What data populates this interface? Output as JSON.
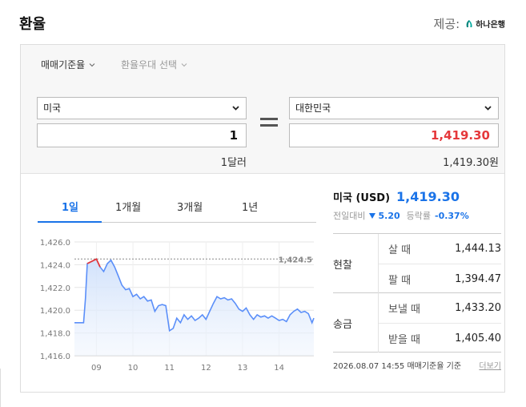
{
  "header": {
    "title": "환율",
    "provider_label": "제공:",
    "provider_name": "하나은행"
  },
  "selectors": {
    "basis_label": "매매기준율",
    "preference_label": "환율우대 선택"
  },
  "converter": {
    "from_country": "미국",
    "from_amount": "1",
    "from_unit_note": "1달러",
    "to_country": "대한민국",
    "to_amount": "1,419.30",
    "to_unit_note": "1,419.30원"
  },
  "tabs": [
    "1일",
    "1개월",
    "3개월",
    "1년"
  ],
  "info": {
    "currency_name": "미국 (USD)",
    "rate": "1,419.30",
    "prev_label": "전일대비",
    "change": "5.20",
    "pct_label": "등락률",
    "pct": "-0.37%"
  },
  "rates": [
    {
      "group": "현찰",
      "rows": [
        {
          "label": "살 때",
          "value": "1,444.13"
        },
        {
          "label": "팔 때",
          "value": "1,394.47"
        }
      ]
    },
    {
      "group": "송금",
      "rows": [
        {
          "label": "보낼 때",
          "value": "1,433.20"
        },
        {
          "label": "받을 때",
          "value": "1,405.40"
        }
      ]
    }
  ],
  "footer": {
    "timestamp": "2026.08.07 14:55",
    "basis_note": "매매기준율 기준",
    "more_label": "더보기"
  },
  "colors": {
    "accent": "#1a73e8",
    "price_red": "#e5383b",
    "line": "#5b8ff9",
    "peak": "#e5383b"
  },
  "chart_data": {
    "type": "area",
    "ylim": [
      1416,
      1426
    ],
    "yticks": [
      "1,416.0",
      "1,418.0",
      "1,420.0",
      "1,422.0",
      "1,424.0",
      "1,426.0"
    ],
    "xticks": [
      "09",
      "10",
      "11",
      "12",
      "13",
      "14"
    ],
    "xtick_hours": [
      9,
      10,
      11,
      12,
      13,
      14
    ],
    "xlim": [
      8.4,
      14.95
    ],
    "peak_label": "1,424.5",
    "peak_value": 1424.5,
    "grid": true,
    "x": [
      8.4,
      8.65,
      8.7,
      8.75,
      9.0,
      9.1,
      9.2,
      9.3,
      9.4,
      9.5,
      9.6,
      9.7,
      9.8,
      9.9,
      10.0,
      10.1,
      10.2,
      10.3,
      10.4,
      10.5,
      10.6,
      10.7,
      10.8,
      10.9,
      11.0,
      11.1,
      11.2,
      11.3,
      11.4,
      11.5,
      11.6,
      11.7,
      11.8,
      11.9,
      12.0,
      12.1,
      12.2,
      12.3,
      12.4,
      12.5,
      12.6,
      12.7,
      12.8,
      12.9,
      13.0,
      13.1,
      13.2,
      13.3,
      13.4,
      13.5,
      13.6,
      13.7,
      13.8,
      13.9,
      14.0,
      14.1,
      14.2,
      14.3,
      14.4,
      14.5,
      14.6,
      14.7,
      14.8,
      14.9,
      14.95
    ],
    "y": [
      1418.9,
      1418.9,
      1421.0,
      1424.1,
      1424.5,
      1423.8,
      1423.4,
      1424.1,
      1424.4,
      1423.8,
      1423.0,
      1422.2,
      1421.8,
      1421.9,
      1421.2,
      1421.4,
      1421.0,
      1421.2,
      1420.8,
      1420.9,
      1419.9,
      1420.4,
      1420.5,
      1420.4,
      1418.2,
      1418.4,
      1419.3,
      1418.9,
      1419.6,
      1419.2,
      1419.5,
      1419.1,
      1419.3,
      1419.6,
      1419.2,
      1419.9,
      1420.6,
      1421.2,
      1421.0,
      1421.1,
      1420.9,
      1421.0,
      1420.6,
      1420.1,
      1419.9,
      1420.2,
      1419.6,
      1419.2,
      1419.6,
      1419.4,
      1419.5,
      1419.3,
      1419.5,
      1419.3,
      1419.1,
      1419.2,
      1419.0,
      1419.6,
      1419.9,
      1420.1,
      1419.8,
      1419.9,
      1419.7,
      1418.9,
      1419.3
    ]
  }
}
